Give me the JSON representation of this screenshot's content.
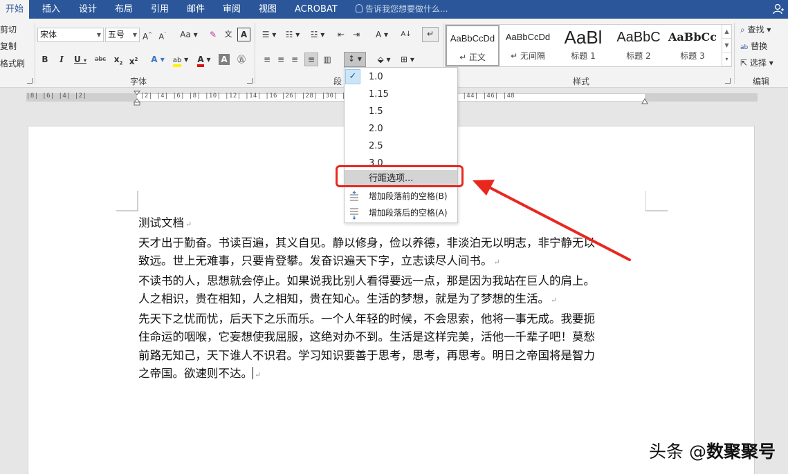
{
  "tabs": [
    "开始",
    "插入",
    "设计",
    "布局",
    "引用",
    "邮件",
    "审阅",
    "视图",
    "ACROBAT"
  ],
  "tell_me": "告诉我您想要做什么...",
  "clipboard": {
    "cut": "剪切",
    "copy": "复制",
    "format_painter": "格式刷"
  },
  "font": {
    "name": "宋体",
    "size": "五号",
    "group_label": "字体",
    "case_label": "Aa"
  },
  "paragraph": {
    "group_label": "段"
  },
  "styles": {
    "group_label": "样式",
    "items": [
      {
        "preview": "AaBbCcDd",
        "name": "↵ 正文"
      },
      {
        "preview": "AaBbCcDd",
        "name": "↵ 无间隔"
      },
      {
        "preview": "AaBl",
        "name": "标题 1"
      },
      {
        "preview": "AaBbC",
        "name": "标题 2"
      },
      {
        "preview": "AaBbCc",
        "name": "标题 3"
      }
    ]
  },
  "editing": {
    "group_label": "编辑",
    "find": "查找",
    "replace": "替换",
    "select": "选择"
  },
  "ruler": {
    "left_text": "|8|  |6|  |4|  |2|",
    "right_text": "|2|  |4|  |6|  |8|  |10|  |12|  |14|  |16                                    |26|  |28|  |30|  |32|  |34|  |36|  |38|  |40|  |42|  |44|  |46|  |48"
  },
  "line_spacing_menu": {
    "options": [
      "1.0",
      "1.15",
      "1.5",
      "2.0",
      "2.5",
      "3.0"
    ],
    "checked": "1.0",
    "line_spacing_options": "行距选项...",
    "add_before": "增加段落前的空格(B)",
    "add_after": "增加段落后的空格(A)"
  },
  "document": {
    "lines": [
      {
        "text": "测试文档",
        "mark": "↵"
      },
      {
        "text": "天才出于勤奋。书读百遍，其义自见。静以修身，俭以养德，非淡泊无以明志，非宁静无以",
        "mark": ""
      },
      {
        "text": "致远。世上无难事，只要肯登攀。发奋识遍天下字，立志读尽人间书。",
        "mark": "↵"
      },
      {
        "text": "不读书的人，思想就会停止。如果说我比别人看得要远一点，那是因为我站在巨人的肩上。",
        "mark": ""
      },
      {
        "text": "人之相识，贵在相知，人之相知，贵在知心。生活的梦想，就是为了梦想的生活。",
        "mark": "↵"
      },
      {
        "text": "先天下之忧而忧，后天下之乐而乐。一个人年轻的时候，不会思索，他将一事无成。我要扼",
        "mark": ""
      },
      {
        "text": "住命运的咽喉，它妄想使我屈服，这绝对办不到。生活是这样完美，活他一千辈子吧！莫愁",
        "mark": ""
      },
      {
        "text": "前路无知己，天下谁人不识君。学习知识要善于思考，思考，再思考。明日之帝国将是智力",
        "mark": ""
      },
      {
        "text": "之帝国。欲速则不达。",
        "mark": "↵"
      }
    ]
  },
  "watermark": {
    "prefix": "头条 @",
    "name": "数聚聚号"
  },
  "colors": {
    "accent": "#2b579a",
    "highlight": "#e8281f"
  }
}
